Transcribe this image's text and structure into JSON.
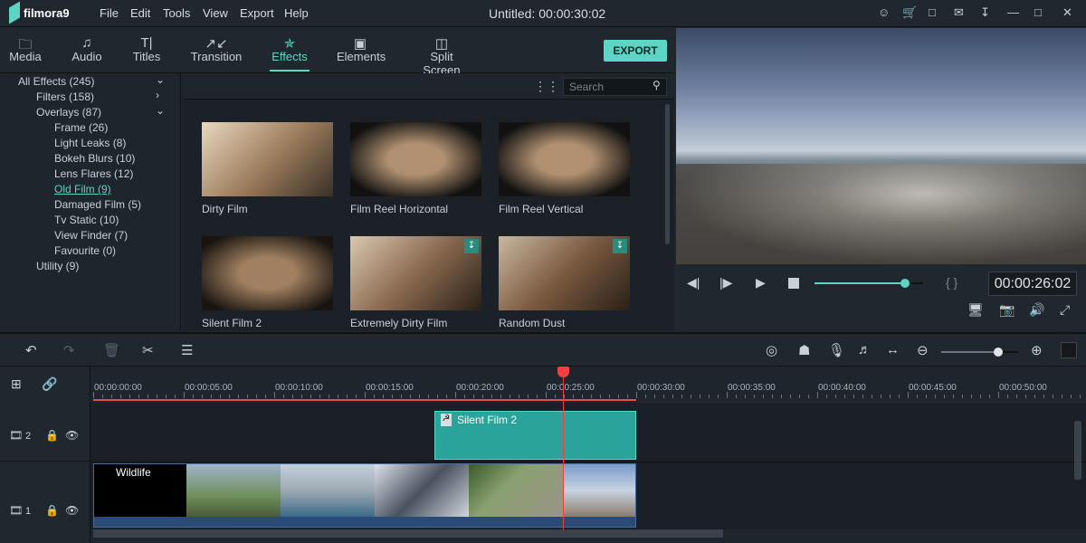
{
  "app": {
    "name": "filmora9",
    "title": "Untitled: 00:00:30:02"
  },
  "menu": [
    "File",
    "Edit",
    "Tools",
    "View",
    "Export",
    "Help"
  ],
  "window_icons": [
    "user-icon",
    "cart-icon",
    "save-icon",
    "mail-icon",
    "download-icon",
    "minimize-icon",
    "maximize-icon",
    "close-icon"
  ],
  "tabs": [
    {
      "label": "Media",
      "icon": "folder-icon"
    },
    {
      "label": "Audio",
      "icon": "music-note-icon"
    },
    {
      "label": "Titles",
      "icon": "text-icon"
    },
    {
      "label": "Transition",
      "icon": "transition-icon"
    },
    {
      "label": "Effects",
      "icon": "effects-icon",
      "active": true
    },
    {
      "label": "Elements",
      "icon": "image-icon"
    },
    {
      "label": "Split Screen",
      "icon": "split-screen-icon"
    }
  ],
  "export_label": "EXPORT",
  "tree": [
    {
      "label": "All Effects (245)",
      "level": 0
    },
    {
      "label": "Filters (158)",
      "level": 1
    },
    {
      "label": "Overlays (87)",
      "level": 1
    },
    {
      "label": "Frame (26)",
      "level": 2
    },
    {
      "label": "Light Leaks (8)",
      "level": 2
    },
    {
      "label": "Bokeh Blurs (10)",
      "level": 2
    },
    {
      "label": "Lens Flares (12)",
      "level": 2
    },
    {
      "label": "Old Film (9)",
      "level": 2,
      "selected": true
    },
    {
      "label": "Damaged Film (5)",
      "level": 2
    },
    {
      "label": "Tv Static (10)",
      "level": 2
    },
    {
      "label": "View Finder (7)",
      "level": 2
    },
    {
      "label": "Favourite (0)",
      "level": 2
    },
    {
      "label": "Utility (9)",
      "level": 1
    }
  ],
  "search_placeholder": "Search",
  "effects": [
    {
      "label": "Dirty Film"
    },
    {
      "label": "Film Reel Horizontal"
    },
    {
      "label": "Film Reel Vertical"
    },
    {
      "label": "Silent Film 2"
    },
    {
      "label": "Extremely Dirty Film",
      "download": true
    },
    {
      "label": "Random Dust",
      "download": true
    }
  ],
  "player": {
    "timecode": "00:00:26:02",
    "progress": 0.83,
    "brackets": "{   }"
  },
  "timeline": {
    "zoom": 0.74,
    "ticks": [
      "00:00:00:00",
      "00:00:05:00",
      "00:00:10:00",
      "00:00:15:00",
      "00:00:20:00",
      "00:00:25:00",
      "00:00:30:00",
      "00:00:35:00",
      "00:00:40:00",
      "00:00:45:00",
      "00:00:50:00"
    ],
    "tracks": [
      {
        "num": "2"
      },
      {
        "num": "1"
      }
    ],
    "effect_clip": "Silent Film 2",
    "video_clip": "Wildlife"
  },
  "colors": {
    "accent": "#5dd5c5",
    "playhead": "#f04040",
    "clip": "#2aa39a"
  }
}
